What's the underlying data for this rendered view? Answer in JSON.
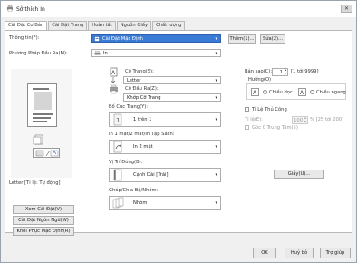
{
  "window": {
    "title": "Sở thích In",
    "close_glyph": "✕"
  },
  "tabs": [
    "Cài Đặt Cơ Bản",
    "Cài Đặt Trang",
    "Hoàn tất",
    "Nguồn Giấy",
    "Chất lượng"
  ],
  "profile": {
    "label": "Thông tin(F):",
    "value": "Cài Đặt Mặc Định",
    "add_label": "Thêm(1)...",
    "edit_label": "Sửa(2)..."
  },
  "output": {
    "label": "Phương Pháp Đầu Ra(M):",
    "value": "In"
  },
  "preview": {
    "caption": "Letter [Tỉ lệ: Tự động]",
    "view_settings": "Xem Cài Đặt(V)",
    "language": "Cài Đặt Ngôn Ngữ(W)",
    "restore": "Khôi Phục Mặc Định(R)"
  },
  "page_size": {
    "label": "Cỡ Trang(S):",
    "value": "Letter"
  },
  "output_size": {
    "label": "Cỡ Đầu Ra(Z):",
    "value": "Khớp Cỡ Trang"
  },
  "layout": {
    "label": "Bố Cục Trang(Y):",
    "value": "1 trên 1"
  },
  "duplex": {
    "label": "In 1 mặt/2 mặt/In Tập Sách:",
    "value": "In 2 mặt"
  },
  "binding": {
    "label": "Vị Trí Đóng(B):",
    "value": "Cạnh Dài [Trái]"
  },
  "collate": {
    "label": "Ghép/Chia Bộ/Nhóm:",
    "value": "Nhóm"
  },
  "copies": {
    "label": "Bản sao(C):",
    "value": "1",
    "range": "[1 tới 9999]"
  },
  "orientation": {
    "label": "Hướng(O)",
    "portrait": "Chiều dọc",
    "landscape": "Chiều ngang",
    "selected": "portrait"
  },
  "scaling": {
    "label": "Tỉ Lệ Thủ Công",
    "pct_label": "Tỉ lệ(E):",
    "value": "100",
    "range": "% [25 tới 200]"
  },
  "rotate": {
    "label": "Góc 0 Trung Tâm(5)"
  },
  "paper_button": "Giấy(U)...",
  "footer": {
    "ok": "OK",
    "cancel": "Huỷ bỏ",
    "help": "Trợ giúp"
  }
}
